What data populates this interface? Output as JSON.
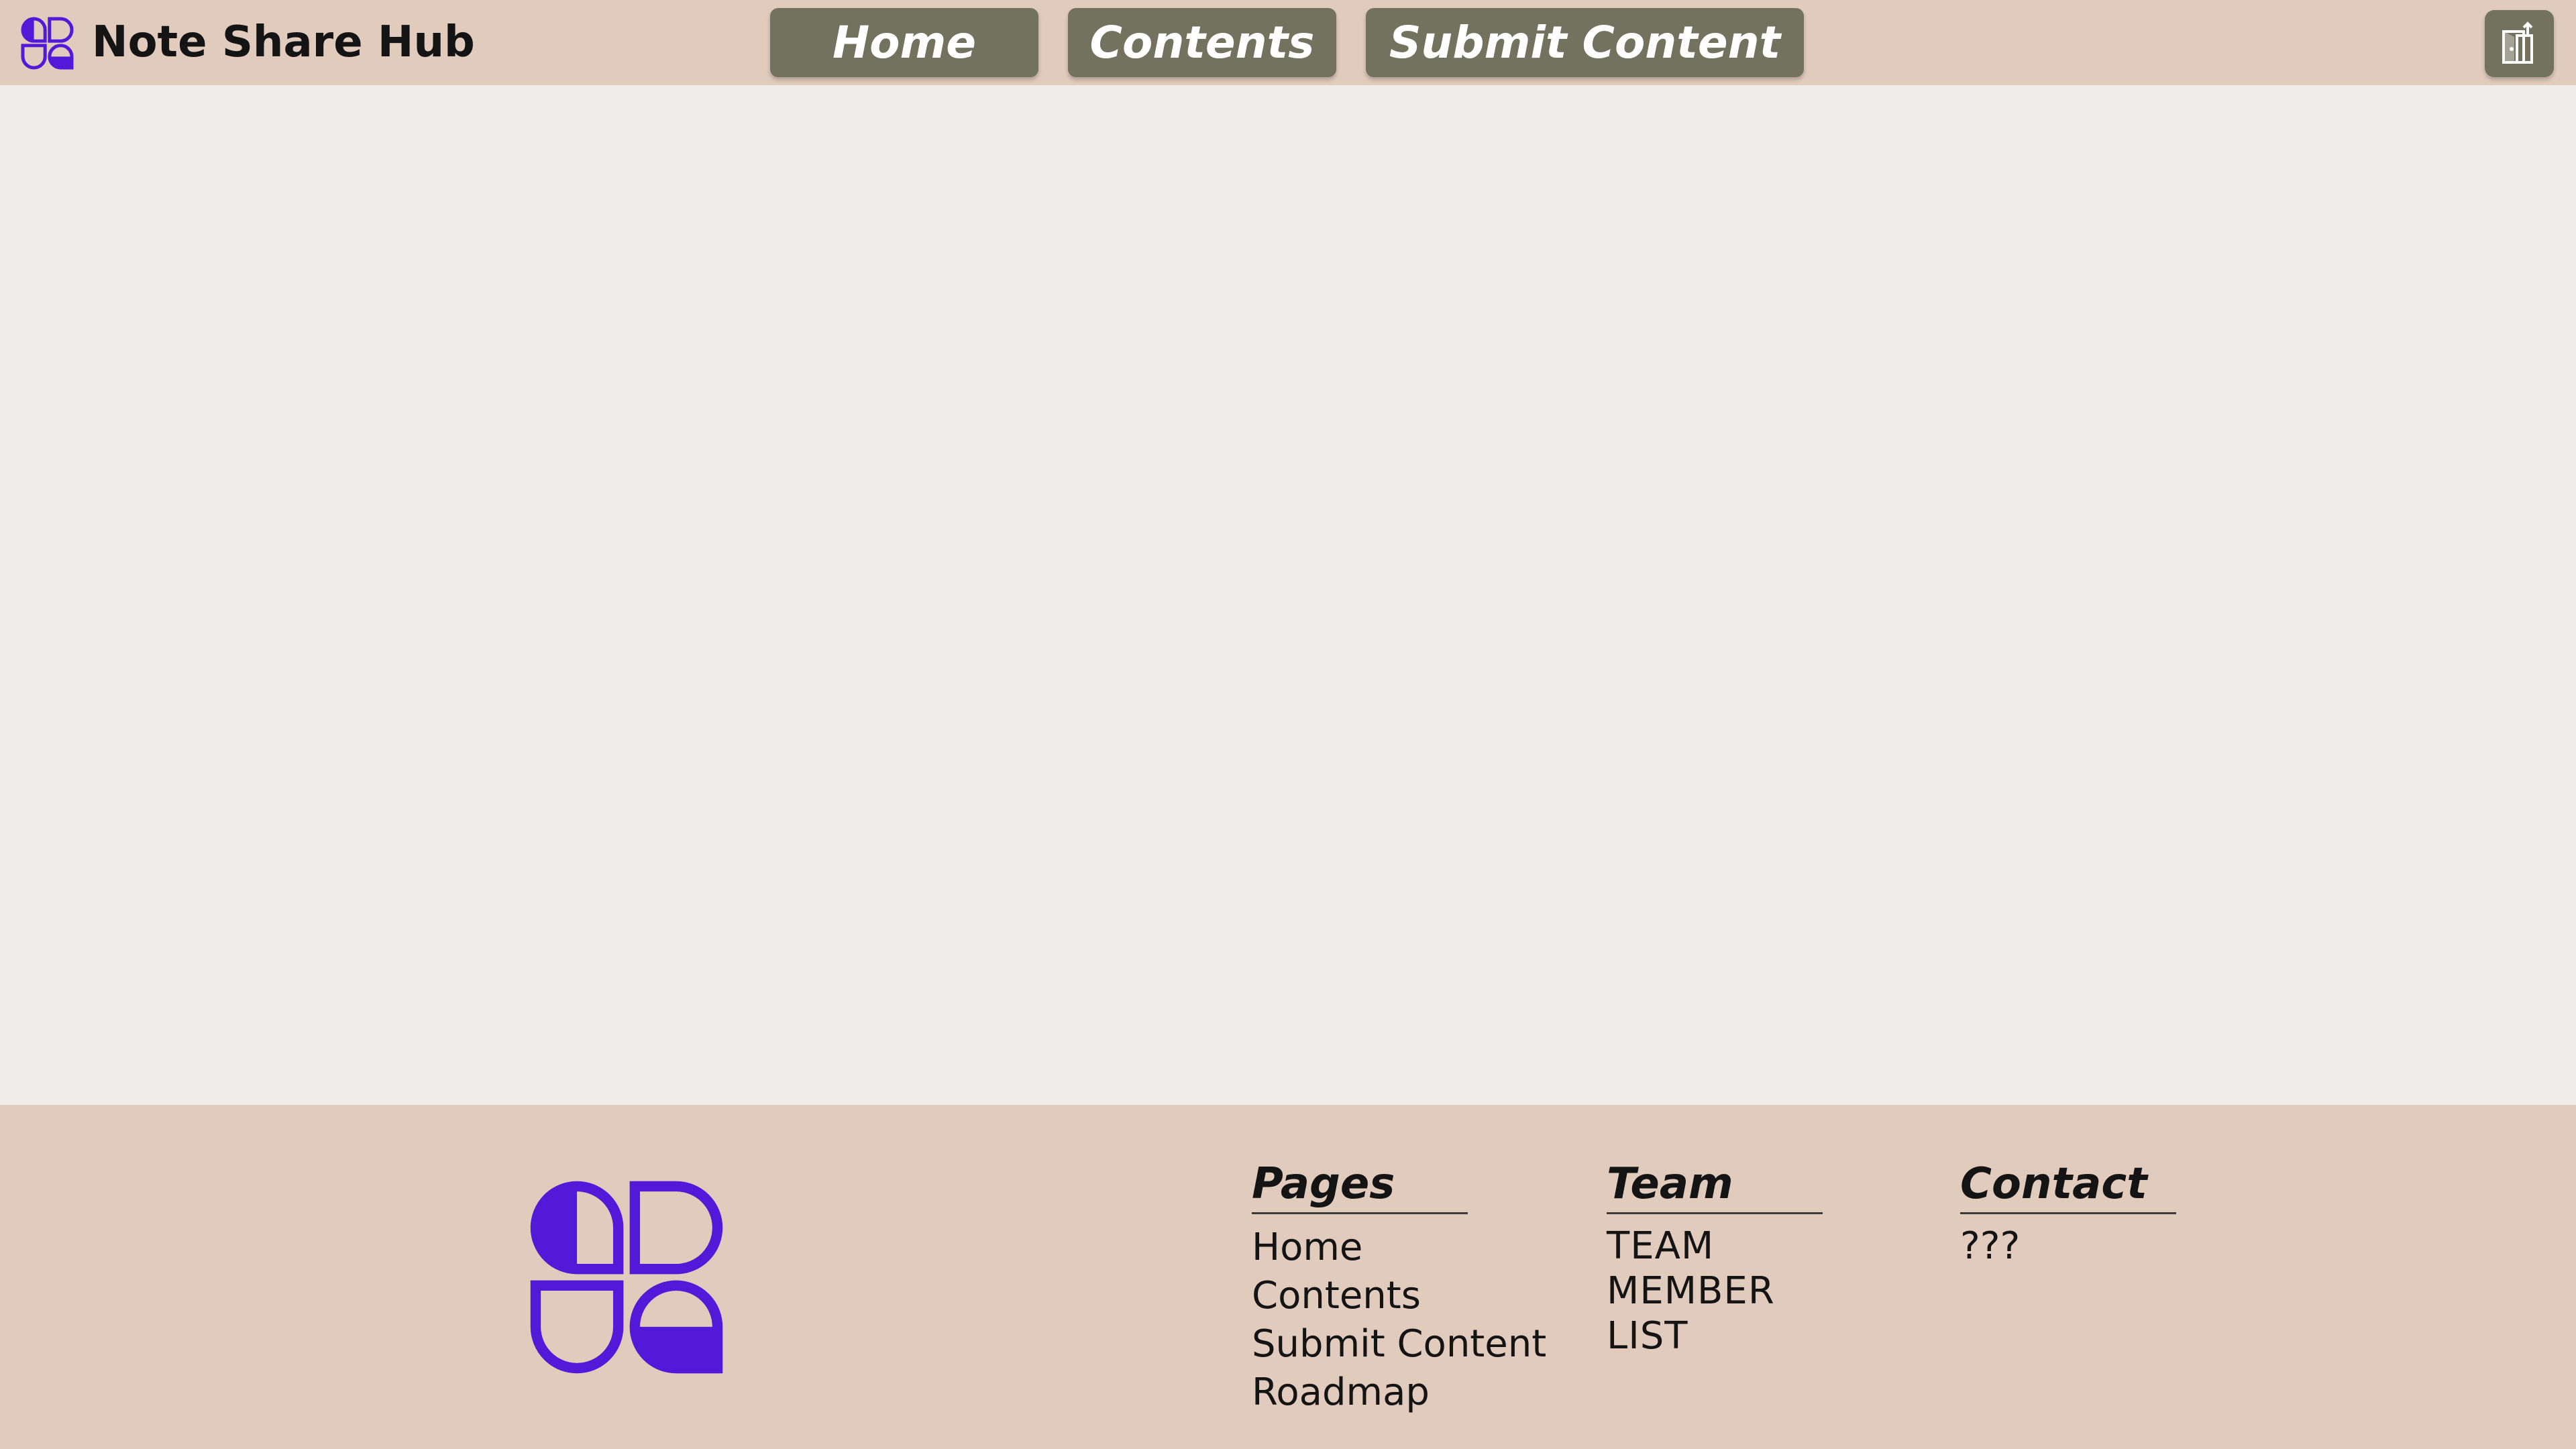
{
  "header": {
    "brand_name": "Note Share Hub",
    "brand_logo_icon": "note-share-hub-logo-icon",
    "nav": [
      {
        "label": "Home"
      },
      {
        "label": "Contents"
      },
      {
        "label": "Submit Content"
      }
    ],
    "corner_icon": "login-door-icon"
  },
  "footer": {
    "logo_icon": "note-share-hub-logo-icon",
    "columns": {
      "pages": {
        "heading": "Pages",
        "items": [
          "Home",
          "Contents",
          "Submit Content",
          "Roadmap"
        ]
      },
      "team": {
        "heading": "Team",
        "text": "TEAM MEMBER LIST"
      },
      "contact": {
        "heading": "Contact",
        "text": "???"
      }
    }
  },
  "colors": {
    "header_bg": "#e0cbbd",
    "page_bg": "#efedeb",
    "nav_button_bg": "#72725f",
    "brand_purple": "#5318d8",
    "text": "#141414"
  }
}
